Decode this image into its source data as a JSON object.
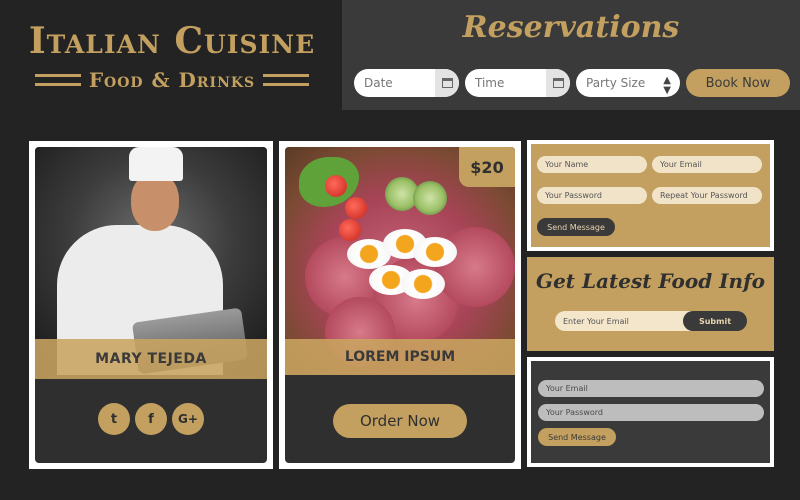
{
  "logo": {
    "title": "Italian Cuisine",
    "subtitle": "Food & Drinks"
  },
  "reservations": {
    "title": "Reservations",
    "date_placeholder": "Date",
    "time_placeholder": "Time",
    "party_size_selected": "Party Size",
    "book_label": "Book Now"
  },
  "chef_card": {
    "name": "MARY TEJEDA",
    "social": [
      {
        "icon": "twitter-icon",
        "glyph": "t"
      },
      {
        "icon": "facebook-icon",
        "glyph": "f"
      },
      {
        "icon": "google-plus-icon",
        "glyph": "G+"
      }
    ]
  },
  "food_card": {
    "price": "$20",
    "name": "LOREM IPSUM",
    "order_label": "Order Now"
  },
  "contact_form": {
    "name_placeholder": "Your Name",
    "email_placeholder": "Your Email",
    "password_placeholder": "Your Password",
    "repeat_password_placeholder": "Repeat Your Password",
    "send_label": "Send Message"
  },
  "food_info": {
    "title": "Get Latest Food Info",
    "email_placeholder": "Enter Your Email",
    "submit_label": "Submit"
  },
  "login_form": {
    "email_placeholder": "Your Email",
    "password_placeholder": "Your Password",
    "send_label": "Send Message"
  },
  "colors": {
    "gold": "#c3a060",
    "dark": "#232323",
    "panel": "#3a3a3a"
  }
}
